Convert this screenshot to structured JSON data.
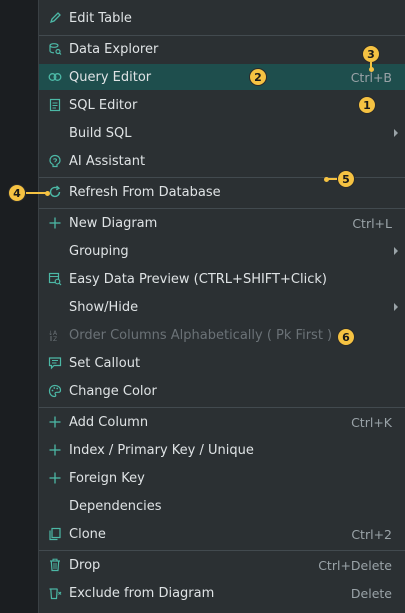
{
  "menu": {
    "edit_table": "Edit Table",
    "data_explorer": "Data Explorer",
    "query_editor": "Query Editor",
    "query_editor_shortcut": "Ctrl+B",
    "sql_editor": "SQL Editor",
    "build_sql": "Build SQL",
    "ai_assistant": "AI Assistant",
    "refresh_from_database": "Refresh From Database",
    "new_diagram": "New Diagram",
    "new_diagram_shortcut": "Ctrl+L",
    "grouping": "Grouping",
    "easy_data_preview": "Easy Data Preview (CTRL+SHIFT+Click)",
    "show_hide": "Show/Hide",
    "order_columns": "Order Columns Alphabetically ( Pk First )",
    "set_callout": "Set Callout",
    "change_color": "Change Color",
    "add_column": "Add Column",
    "add_column_shortcut": "Ctrl+K",
    "index_primary_key": "Index / Primary Key / Unique",
    "foreign_key": "Foreign Key",
    "dependencies": "Dependencies",
    "clone": "Clone",
    "clone_shortcut": "Ctrl+2",
    "drop": "Drop",
    "drop_shortcut": "Ctrl+Delete",
    "exclude_from_diagram": "Exclude from Diagram",
    "exclude_shortcut": "Delete"
  },
  "annotations": {
    "b1": "1",
    "b2": "2",
    "b3": "3",
    "b4": "4",
    "b5": "5",
    "b6": "6",
    "color": "#f5c242"
  },
  "colors": {
    "menu_bg": "#2b3033",
    "highlight": "#1e4e4d",
    "accent_icon": "#4cb8a6"
  }
}
